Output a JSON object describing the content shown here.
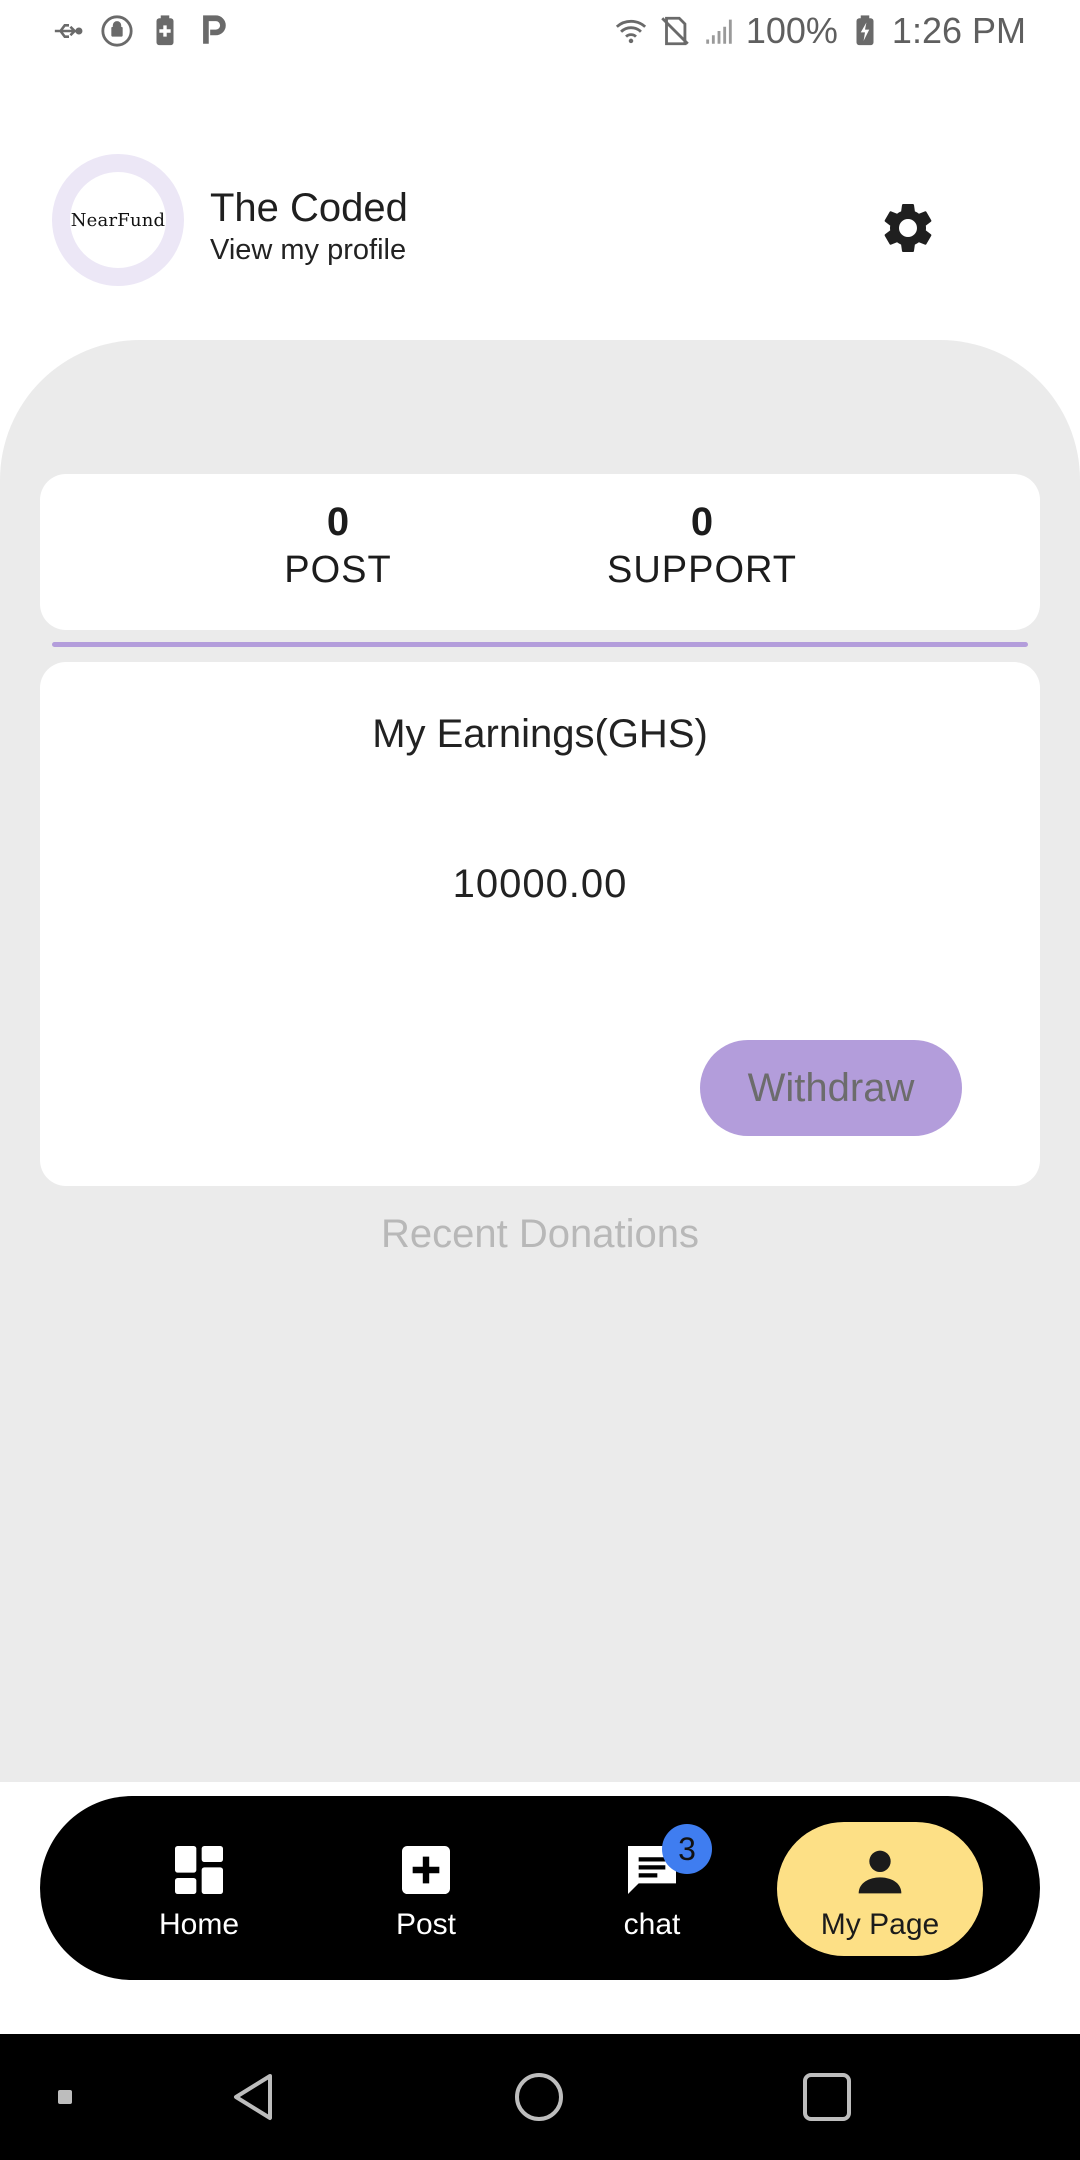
{
  "status_bar": {
    "battery": "100%",
    "time": "1:26 PM",
    "left_icons": [
      "usb-icon",
      "android-sync-icon",
      "battery-plus-icon",
      "p-app-icon"
    ],
    "right_icons": [
      "wifi-lock-icon",
      "no-sim-icon",
      "signal-icon",
      "battery-charging-icon"
    ]
  },
  "profile": {
    "avatar_text": "NearFund",
    "name": "The Coded",
    "link": "View my profile",
    "settings_icon": "gear-icon"
  },
  "stats": [
    {
      "value": "0",
      "label": "POST"
    },
    {
      "value": "0",
      "label": "SUPPORT"
    }
  ],
  "earnings": {
    "title": "My Earnings(GHS)",
    "amount": "10000.00",
    "withdraw_label": "Withdraw"
  },
  "recent_donations_label": "Recent Donations",
  "bottom_nav": {
    "items": [
      {
        "label": "Home",
        "icon": "dashboard-icon"
      },
      {
        "label": "Post",
        "icon": "add-box-icon"
      },
      {
        "label": "chat",
        "icon": "chat-icon",
        "badge": "3"
      },
      {
        "label": "My Page",
        "icon": "person-icon",
        "active": true
      }
    ]
  },
  "system_nav": [
    "recent-dot-icon",
    "back-icon",
    "home-circle-icon",
    "overview-square-icon"
  ],
  "colors": {
    "accent": "#b39ddb",
    "panel": "#ebebeb",
    "nav_active": "#fde086",
    "badge": "#3f7df0"
  }
}
